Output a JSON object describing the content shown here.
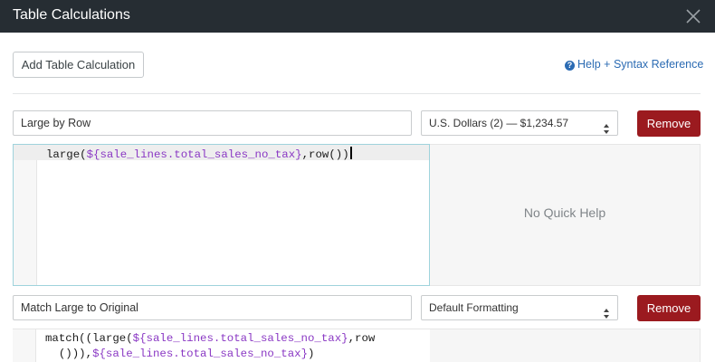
{
  "window": {
    "title": "Table Calculations"
  },
  "toolbar": {
    "add_label": "Add Table Calculation",
    "help_label": "Help + Syntax Reference"
  },
  "calculations": [
    {
      "name": "Large by Row",
      "format": "U.S. Dollars (2) — $1,234.57",
      "remove_label": "Remove",
      "code": {
        "fn": "large(",
        "field": "${sale_lines.total_sales_no_tax}",
        "rest": ",row())"
      },
      "quick_help": "No Quick Help"
    },
    {
      "name": "Match Large to Original",
      "format": "Default Formatting",
      "remove_label": "Remove",
      "code": {
        "fn1": "match((large(",
        "field1": "${sale_lines.total_sales_no_tax}",
        "rest1": ",row",
        "cont": "  ())),",
        "field2": "${sale_lines.total_sales_no_tax}",
        "end": ")"
      }
    }
  ],
  "colors": {
    "titlebar": "#262d33",
    "remove_button": "#9b1a1f",
    "variable_token": "#8a38c4",
    "link": "#2b6bb3"
  },
  "icons": {
    "close": "close-icon",
    "help": "question-circle-icon",
    "select": "up-down-arrows-icon"
  }
}
